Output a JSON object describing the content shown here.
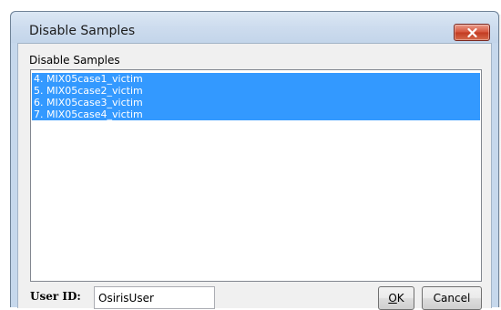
{
  "window": {
    "title": "Disable Samples"
  },
  "group_label": "Disable Samples",
  "samples": [
    {
      "label": "4. MIX05case1_victim",
      "selected": true
    },
    {
      "label": "5. MIX05case2_victim",
      "selected": true
    },
    {
      "label": "6. MIX05case3_victim",
      "selected": true
    },
    {
      "label": "7. MIX05case4_victim",
      "selected": true
    }
  ],
  "footer": {
    "user_id_label": "User ID:",
    "user_id_value": "OsirisUser",
    "ok_label_underlined": "O",
    "ok_label_rest": "K",
    "cancel_label": "Cancel"
  },
  "colors": {
    "selection": "#3399ff",
    "close_button": "#c23b21"
  }
}
